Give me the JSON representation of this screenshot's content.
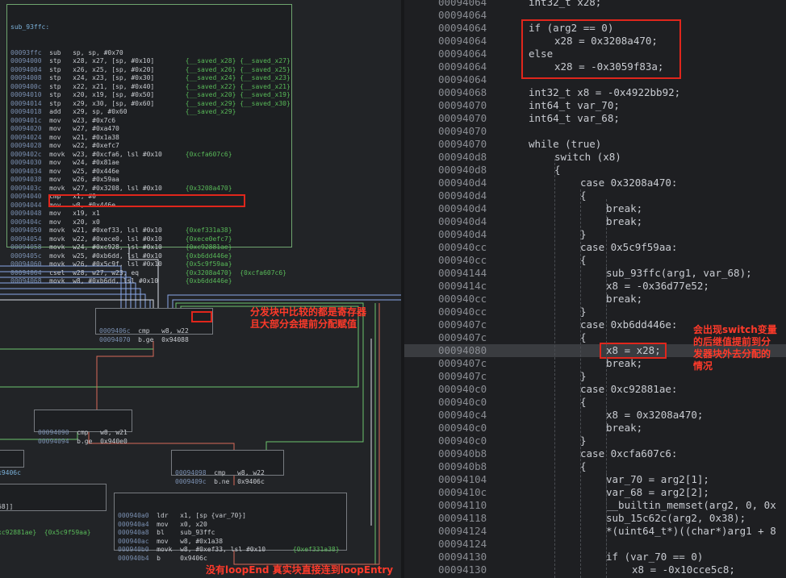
{
  "graph": {
    "main_block": {
      "title": "sub_93ffc:",
      "rows": [
        [
          "00093ffc",
          "sub",
          "sp, sp, #0x70",
          ""
        ],
        [
          "00094000",
          "stp",
          "x28, x27, [sp, #0x10]",
          "{__saved_x28} {__saved_x27}"
        ],
        [
          "00094004",
          "stp",
          "x26, x25, [sp, #0x20]",
          "{__saved_x26} {__saved_x25}"
        ],
        [
          "00094008",
          "stp",
          "x24, x23, [sp, #0x30]",
          "{__saved_x24} {__saved_x23}"
        ],
        [
          "0009400c",
          "stp",
          "x22, x21, [sp, #0x40]",
          "{__saved_x22} {__saved_x21}"
        ],
        [
          "00094010",
          "stp",
          "x20, x19, [sp, #0x50]",
          "{__saved_x20} {__saved_x19}"
        ],
        [
          "00094014",
          "stp",
          "x29, x30, [sp, #0x60]",
          "{__saved_x29} {__saved_x30}"
        ],
        [
          "00094018",
          "add",
          "x29, sp, #0x60",
          "{__saved_x29}"
        ],
        [
          "0009401c",
          "mov",
          "w23, #0x7c6",
          ""
        ],
        [
          "00094020",
          "mov",
          "w27, #0xa470",
          ""
        ],
        [
          "00094024",
          "mov",
          "w21, #0x1a38",
          ""
        ],
        [
          "00094028",
          "mov",
          "w22, #0xefc7",
          ""
        ],
        [
          "0009402c",
          "movk",
          "w23, #0xcfa6, lsl #0x10",
          "{0xcfa607c6}"
        ],
        [
          "00094030",
          "mov",
          "w24, #0x81ae",
          ""
        ],
        [
          "00094034",
          "mov",
          "w25, #0x446e",
          ""
        ],
        [
          "00094038",
          "mov",
          "w26, #0x59aa",
          ""
        ],
        [
          "0009403c",
          "movk",
          "w27, #0x3208, lsl #0x10",
          "{0x3208a470}"
        ],
        [
          "00094040",
          "cmp",
          "x1, #0",
          ""
        ],
        [
          "00094044",
          "mov",
          "w8, #0x446e",
          ""
        ],
        [
          "00094048",
          "mov",
          "x19, x1",
          ""
        ],
        [
          "0009404c",
          "mov",
          "x20, x0",
          ""
        ],
        [
          "00094050",
          "movk",
          "w21, #0xef33, lsl #0x10",
          "{0xef331a38}"
        ],
        [
          "00094054",
          "movk",
          "w22, #0xece0, lsl #0x10",
          "{0xece0efc7}"
        ],
        [
          "00094058",
          "movk",
          "w24, #0xc928, lsl #0x10",
          "{0xc92881ae}"
        ],
        [
          "0009405c",
          "movk",
          "w25, #0xb6dd, lsl #0x10",
          "{0xb6dd446e}"
        ],
        [
          "00094060",
          "movk",
          "w26, #0x5c9f, lsl #0x10",
          "{0x5c9f59aa}"
        ],
        [
          "00094064",
          "csel",
          "w28, w27, w23, eq",
          "{0x3208a470}  {0xcfa607c6}"
        ],
        [
          "00094068",
          "movk",
          "w8, #0xb6dd, lsl #0x10",
          "{0xb6dd446e}"
        ]
      ]
    },
    "dispatch_block": {
      "rows": [
        [
          "0009406c",
          "cmp",
          "w8, w22"
        ],
        [
          "00094070",
          "b.ge",
          "0x94088"
        ]
      ]
    },
    "block_90": {
      "rows": [
        [
          "00094090",
          "cmp",
          "w8, w21"
        ],
        [
          "00094094",
          "b.ge",
          "0x940e0"
        ]
      ]
    },
    "block_98": {
      "rows": [
        [
          "00094098",
          "cmp",
          "w8, w22"
        ],
        [
          "0009409c",
          "b.ne",
          "0x9406c"
        ]
      ]
    },
    "block_a0": {
      "rows": [
        [
          "000940a0",
          "ldr",
          "x1, [sp {var_70}]"
        ],
        [
          "000940a4",
          "mov",
          "x0, x20"
        ],
        [
          "000940a8",
          "bl",
          "sub_93ffc"
        ],
        [
          "000940ac",
          "mov",
          "w8, #0x1a38"
        ],
        [
          "000940b0",
          "movk",
          "w8, #0xef33, lsl #0x10",
          "{0xef331a38}"
        ],
        [
          "000940b4",
          "b",
          "0x9406c"
        ]
      ]
    },
    "left_frag_1": "x9406c",
    "left_frag_2_top": "68]]",
    "left_frag_2_bottom": "xc92881ae}  {0x5c9f59aa}"
  },
  "code": {
    "lines": [
      {
        "addr": "00094064",
        "indent": 1,
        "text": "int32_t x28;"
      },
      {
        "addr": "00094064",
        "indent": 1,
        "text": ""
      },
      {
        "addr": "00094064",
        "indent": 1,
        "text": "if (arg2 == 0)"
      },
      {
        "addr": "00094064",
        "indent": 2,
        "text": "x28 = 0x3208a470;"
      },
      {
        "addr": "00094064",
        "indent": 1,
        "text": "else"
      },
      {
        "addr": "00094064",
        "indent": 2,
        "text": "x28 = -0x3059f83a;"
      },
      {
        "addr": "00094064",
        "indent": 1,
        "text": ""
      },
      {
        "addr": "00094068",
        "indent": 1,
        "text": "int32_t x8 = -0x4922bb92;"
      },
      {
        "addr": "00094070",
        "indent": 1,
        "text": "int64_t var_70;"
      },
      {
        "addr": "00094070",
        "indent": 1,
        "text": "int64_t var_68;"
      },
      {
        "addr": "00094070",
        "indent": 1,
        "text": ""
      },
      {
        "addr": "00094070",
        "indent": 1,
        "text": "while (true)"
      },
      {
        "addr": "000940d8",
        "indent": 2,
        "text": "switch (x8)"
      },
      {
        "addr": "000940d8",
        "indent": 2,
        "text": "{"
      },
      {
        "addr": "000940d4",
        "indent": 3,
        "text": "case 0x3208a470:"
      },
      {
        "addr": "000940d4",
        "indent": 3,
        "text": "{"
      },
      {
        "addr": "000940d4",
        "indent": 4,
        "text": "break;"
      },
      {
        "addr": "000940d4",
        "indent": 4,
        "text": "break;"
      },
      {
        "addr": "000940d4",
        "indent": 3,
        "text": "}"
      },
      {
        "addr": "000940cc",
        "indent": 3,
        "text": "case 0x5c9f59aa:"
      },
      {
        "addr": "000940cc",
        "indent": 3,
        "text": "{"
      },
      {
        "addr": "00094144",
        "indent": 4,
        "text": "sub_93ffc(arg1, var_68);"
      },
      {
        "addr": "0009414c",
        "indent": 4,
        "text": "x8 = -0x36d77e52;"
      },
      {
        "addr": "000940cc",
        "indent": 4,
        "text": "break;"
      },
      {
        "addr": "000940cc",
        "indent": 3,
        "text": "}"
      },
      {
        "addr": "0009407c",
        "indent": 3,
        "text": "case 0xb6dd446e:"
      },
      {
        "addr": "0009407c",
        "indent": 3,
        "text": "{"
      },
      {
        "addr": "00094080",
        "indent": 4,
        "text": "x8 = x28;",
        "highlight": true
      },
      {
        "addr": "0009407c",
        "indent": 4,
        "text": "break;"
      },
      {
        "addr": "0009407c",
        "indent": 3,
        "text": "}"
      },
      {
        "addr": "000940c0",
        "indent": 3,
        "text": "case 0xc92881ae:"
      },
      {
        "addr": "000940c0",
        "indent": 3,
        "text": "{"
      },
      {
        "addr": "000940c4",
        "indent": 4,
        "text": "x8 = 0x3208a470;"
      },
      {
        "addr": "000940c0",
        "indent": 4,
        "text": "break;"
      },
      {
        "addr": "000940c0",
        "indent": 3,
        "text": "}"
      },
      {
        "addr": "000940b8",
        "indent": 3,
        "text": "case 0xcfa607c6:"
      },
      {
        "addr": "000940b8",
        "indent": 3,
        "text": "{"
      },
      {
        "addr": "00094104",
        "indent": 4,
        "text": "var_70 = arg2[1];"
      },
      {
        "addr": "0009410c",
        "indent": 4,
        "text": "var_68 = arg2[2];"
      },
      {
        "addr": "00094110",
        "indent": 4,
        "text": "__builtin_memset(arg2, 0, 0x"
      },
      {
        "addr": "00094118",
        "indent": 4,
        "text": "sub_15c62c(arg2, 0x38);"
      },
      {
        "addr": "00094124",
        "indent": 4,
        "text": "*(uint64_t*)((char*)arg1 + 8"
      },
      {
        "addr": "00094124",
        "indent": 4,
        "text": ""
      },
      {
        "addr": "00094130",
        "indent": 4,
        "text": "if (var_70 == 0)"
      },
      {
        "addr": "00094130",
        "indent": 5,
        "text": "x8 = -0x10cce5c8;"
      }
    ]
  },
  "annotations": {
    "note_dispatch": "分发块中比较的都是寄存器\n且大部分会提前分配赋值",
    "note_switch": "会出现switch变量\n的后继值提前到分\n发器块外去分配的\n情况",
    "note_loop": "没有loopEnd 真实块直接连到loopEntry"
  },
  "colors": {
    "annotation_red": "#e0261c",
    "addr_gray": "#8a8d93",
    "selected_block_border": "#6fa56f",
    "edge_blue": "#8aa8e8",
    "edge_green": "#6cc46c",
    "edge_red": "#d86a5a",
    "edge_white": "#d8dde4"
  }
}
